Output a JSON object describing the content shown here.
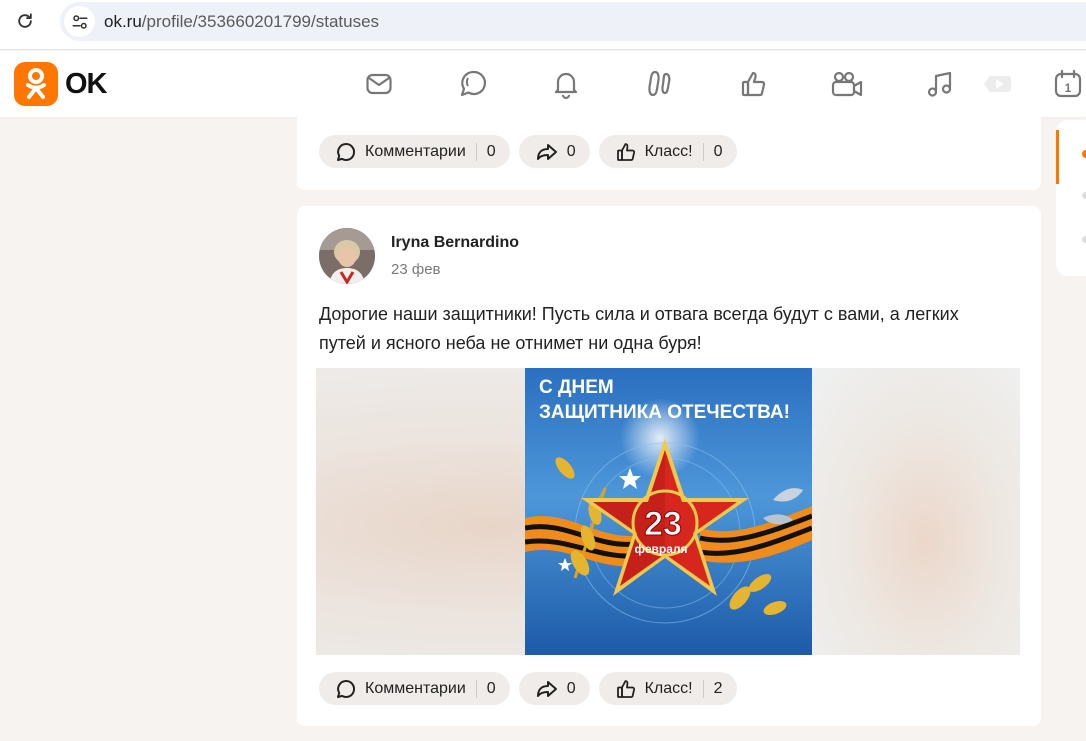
{
  "browser": {
    "url_domain": "ok.ru",
    "url_path": "/profile/353660201799/statuses"
  },
  "header": {
    "logo_text": "OK",
    "nav_icons": [
      "mail-icon",
      "chat-icon",
      "bell-icon",
      "guests-icon",
      "like-icon",
      "video-icon",
      "music-icon",
      "live-icon",
      "calendar-icon"
    ],
    "calendar_day": "1"
  },
  "colors": {
    "brand": "#ff7700",
    "pill_bg": "#f0ece9",
    "page_bg": "#f6f3f0"
  },
  "top_post": {
    "comments_label": "Комментарии",
    "comments_count": "0",
    "share_count": "0",
    "class_label": "Класс!",
    "class_count": "0"
  },
  "post": {
    "author_name": "Iryna Bernardino",
    "date": "23 фев",
    "text": "Дорогие наши защитники! Пусть сила и отвага всегда будут с вами, а легких путей и ясного неба не отнимет ни одна буря!",
    "image": {
      "line1": "С ДНЕМ",
      "line2": "ЗАЩИТНИКА ОТЕЧЕСТВА!",
      "number": "23",
      "month": "февраля"
    },
    "comments_label": "Комментарии",
    "comments_count": "0",
    "share_count": "0",
    "class_label": "Класс!",
    "class_count": "2"
  }
}
